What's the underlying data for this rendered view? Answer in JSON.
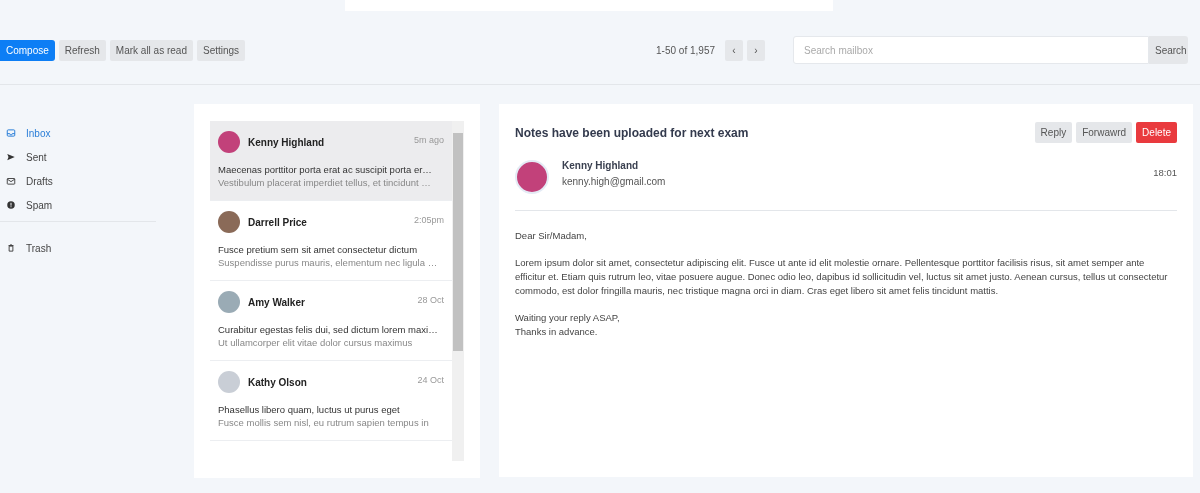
{
  "toolbar": {
    "buttons": [
      {
        "label": "Compose",
        "kind": "primary"
      },
      {
        "label": "Refresh",
        "kind": "default"
      },
      {
        "label": "Mark all as read",
        "kind": "default"
      },
      {
        "label": "Settings",
        "kind": "default"
      }
    ],
    "pagination": {
      "range": "1-50 of 1,957",
      "prev": "‹",
      "next": "›"
    },
    "search": {
      "placeholder": "Search mailbox",
      "button": "Search"
    }
  },
  "sidebar": {
    "groups": [
      [
        {
          "label": "Inbox",
          "kind": "inbox",
          "selected": true
        },
        {
          "label": "Sent",
          "kind": "sent",
          "selected": false
        },
        {
          "label": "Drafts",
          "kind": "drafts",
          "selected": false
        },
        {
          "label": "Spam",
          "kind": "spam",
          "selected": false
        }
      ],
      [
        {
          "label": "Trash",
          "kind": "trash",
          "selected": false
        }
      ]
    ]
  },
  "messages": [
    {
      "sender": "Kenny Highland",
      "time": "5m ago",
      "subject": "Maecenas porttitor porta erat ac suscipit porta er…",
      "preview": "Vestibulum placerat imperdiet tellus, et tincidunt …",
      "selected": true,
      "color": "#c2417a"
    },
    {
      "sender": "Darrell Price",
      "time": "2:05pm",
      "subject": "Fusce pretium sem sit amet consectetur dictum",
      "preview": "Suspendisse purus mauris, elementum nec ligula …",
      "selected": false,
      "color": "#8a6a58"
    },
    {
      "sender": "Amy Walker",
      "time": "28 Oct",
      "subject": "Curabitur egestas felis dui, sed dictum lorem maxi…",
      "preview": "Ut ullamcorper elit vitae dolor cursus maximus",
      "selected": false,
      "color": "#9aabb5"
    },
    {
      "sender": "Kathy Olson",
      "time": "24 Oct",
      "subject": "Phasellus libero quam, luctus ut purus eget",
      "preview": "Fusce mollis sem nisl, eu rutrum sapien tempus in",
      "selected": false,
      "color": "#c9ced6"
    }
  ],
  "reader": {
    "title": "Notes have been uploaded for next exam",
    "actions": [
      {
        "label": "Reply",
        "kind": "default"
      },
      {
        "label": "Forwawrd",
        "kind": "default"
      },
      {
        "label": "Delete",
        "kind": "danger"
      }
    ],
    "from_name": "Kenny Highland",
    "from_email": "kenny.high@gmail.com",
    "time": "18:01",
    "body": [
      "Dear Sir/Madam,",
      "Lorem ipsum dolor sit amet, consectetur adipiscing elit. Fusce ut ante id elit molestie ornare. Pellentesque porttitor facilisis risus, sit amet semper ante efficitur et. Etiam quis rutrum leo, vitae posuere augue. Donec odio leo, dapibus id sollicitudin vel, luctus sit amet justo. Aenean cursus, tellus ut consectetur commodo, est dolor fringilla mauris, nec tristique magna orci in diam. Cras eget libero sit amet felis tincidunt mattis.",
      "Waiting your reply ASAP,\nThanks in advance."
    ]
  }
}
